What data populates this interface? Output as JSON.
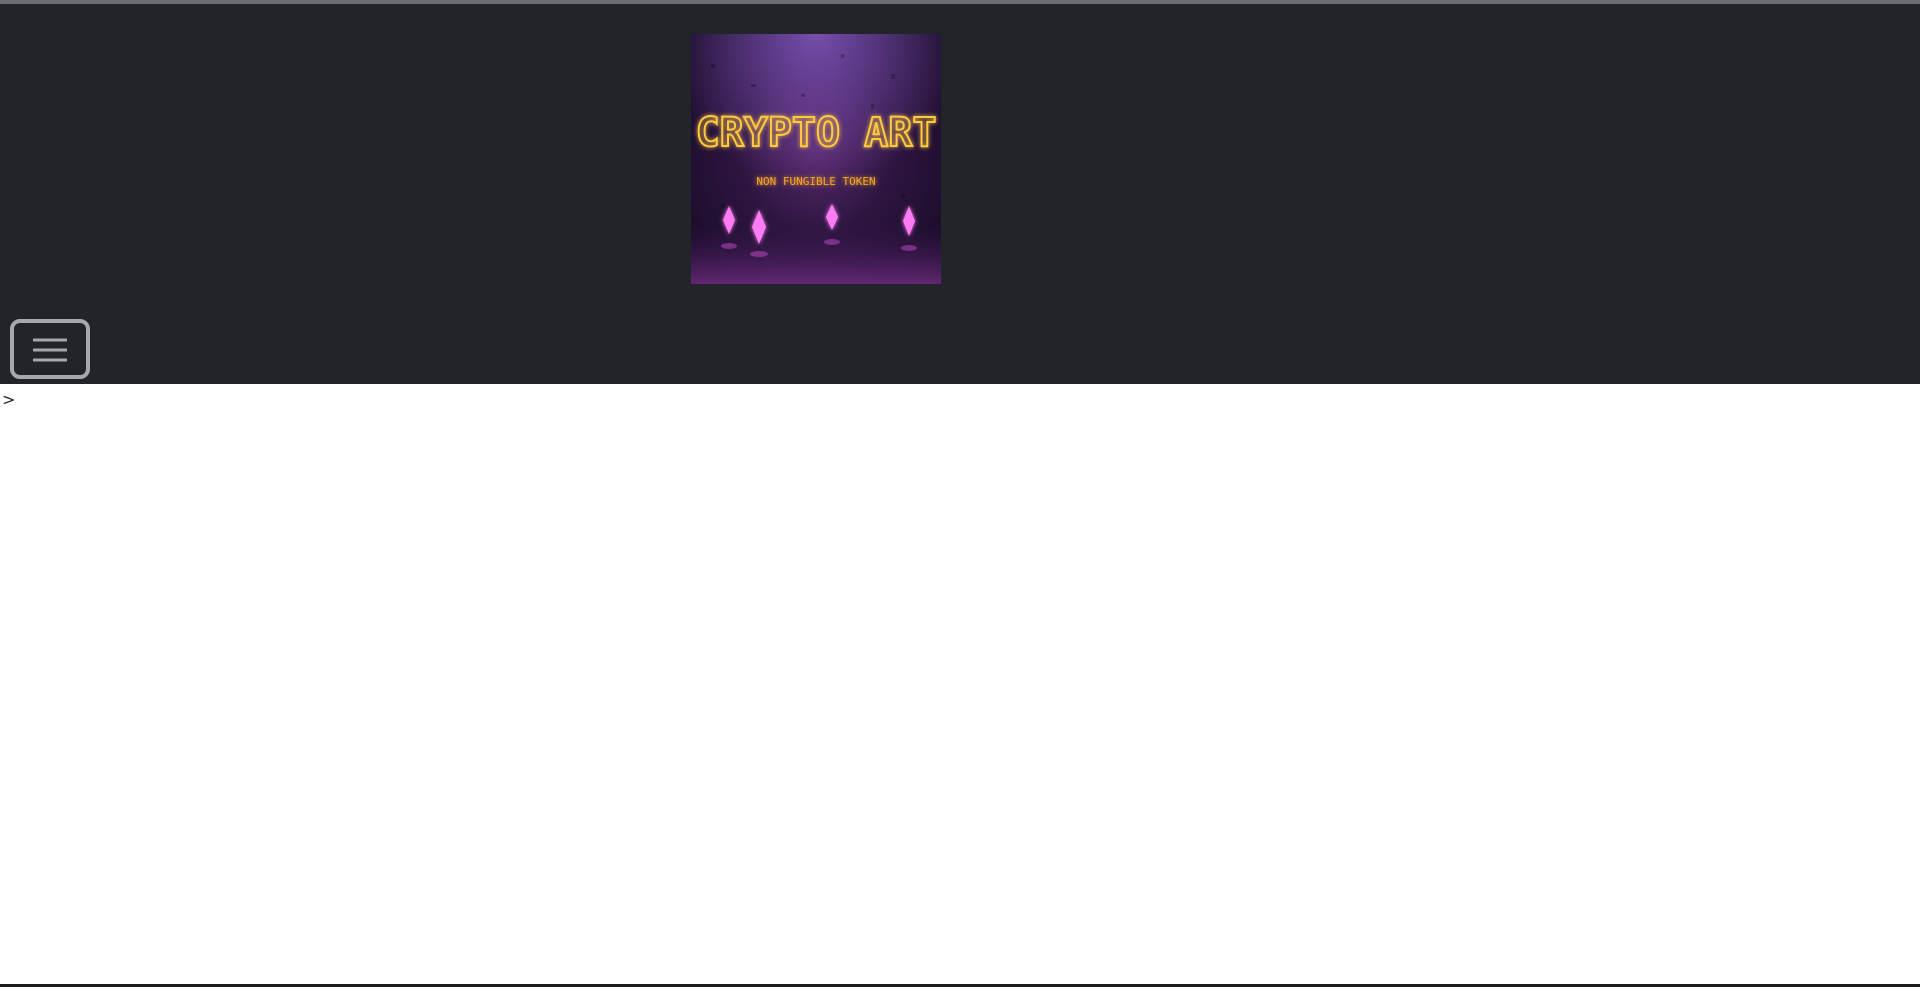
{
  "logo": {
    "title": "CRYPTO ART",
    "subtitle": "NON FUNGIBLE TOKEN",
    "colors": {
      "title": "#ffc93c",
      "subtitle": "#f5a623",
      "crystal": "#ff7bf5"
    }
  },
  "navbar": {
    "toggler_icon": "hamburger-icon",
    "background": "#212529"
  },
  "content": {
    "text": ">"
  }
}
